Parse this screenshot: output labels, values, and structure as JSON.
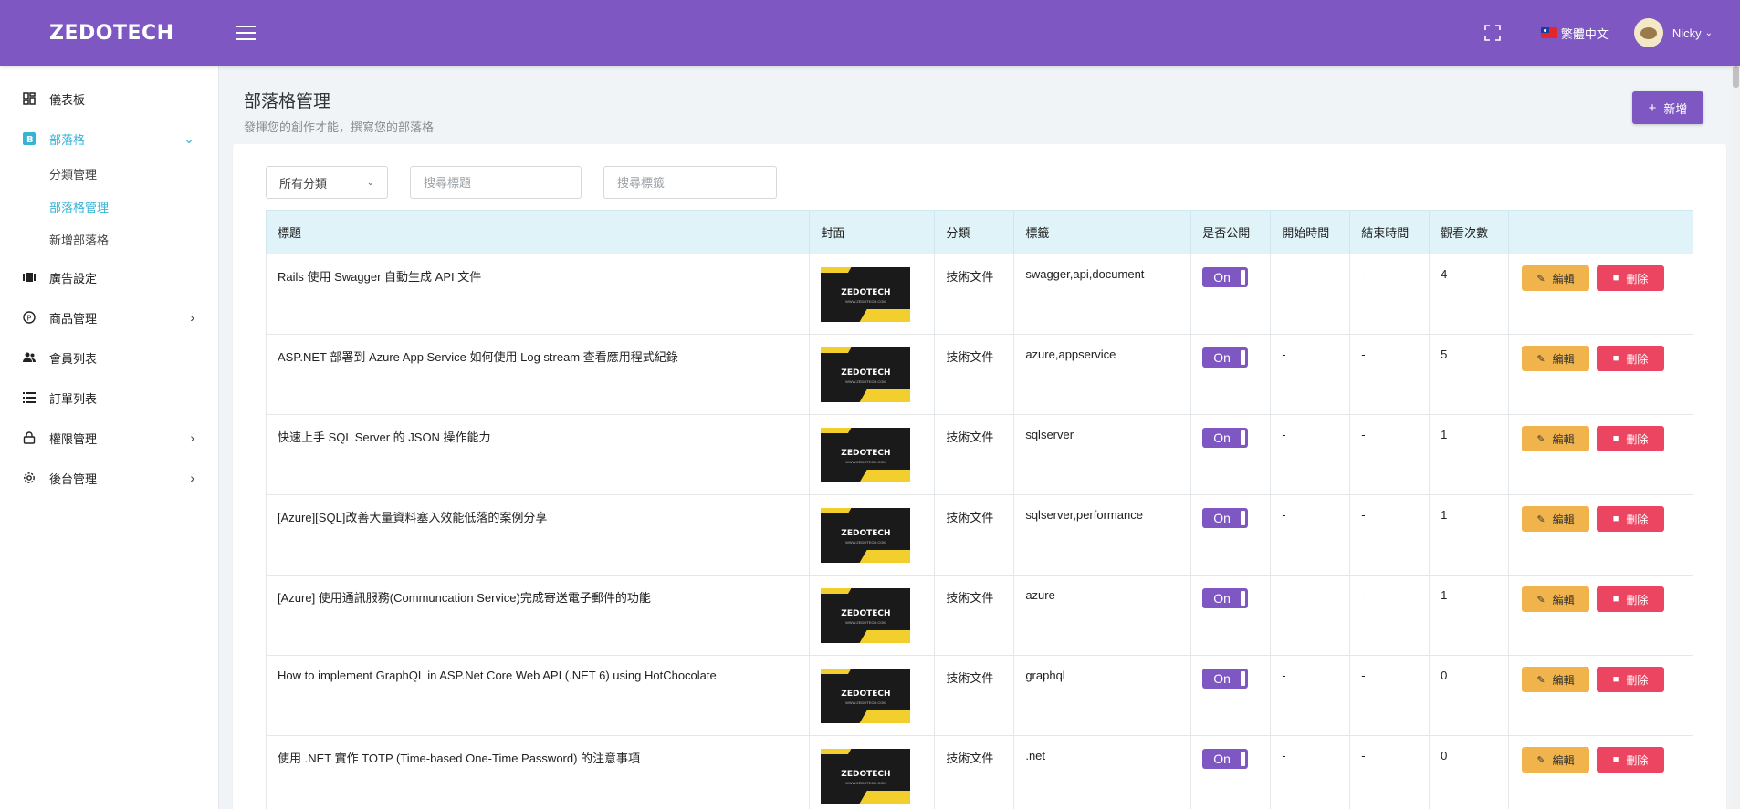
{
  "header": {
    "brand": "ZEDOTECH",
    "language": "繁體中文",
    "user_name": "Nicky"
  },
  "sidebar": {
    "items": [
      {
        "label": "儀表板"
      },
      {
        "label": "部落格"
      },
      {
        "label": "廣告設定"
      },
      {
        "label": "商品管理"
      },
      {
        "label": "會員列表"
      },
      {
        "label": "訂單列表"
      },
      {
        "label": "權限管理"
      },
      {
        "label": "後台管理"
      }
    ],
    "blog_sub": [
      {
        "label": "分類管理"
      },
      {
        "label": "部落格管理"
      },
      {
        "label": "新增部落格"
      }
    ]
  },
  "page": {
    "title": "部落格管理",
    "subtitle": "發揮您的創作才能，撰寫您的部落格",
    "add_label": "新增"
  },
  "filters": {
    "category_selected": "所有分類",
    "title_placeholder": "搜尋標題",
    "tag_placeholder": "搜尋標籤"
  },
  "table": {
    "columns": [
      "標題",
      "封面",
      "分類",
      "標籤",
      "是否公開",
      "開始時間",
      "結束時間",
      "觀看次數",
      ""
    ],
    "cover_logo": "ZEDOTECH",
    "cover_logo_sub": "WWW.ZEDOTECH.COM",
    "edit_label": "編輯",
    "delete_label": "刪除",
    "rows": [
      {
        "title": "Rails 使用 Swagger 自動生成 API 文件",
        "category": "技術文件",
        "tags": "swagger,api,document",
        "public": "On",
        "start": "-",
        "end": "-",
        "views": "4"
      },
      {
        "title": "ASP.NET 部署到 Azure App Service 如何使用 Log stream 查看應用程式紀錄",
        "category": "技術文件",
        "tags": "azure,appservice",
        "public": "On",
        "start": "-",
        "end": "-",
        "views": "5"
      },
      {
        "title": "快速上手 SQL Server 的 JSON 操作能力",
        "category": "技術文件",
        "tags": "sqlserver",
        "public": "On",
        "start": "-",
        "end": "-",
        "views": "1"
      },
      {
        "title": "[Azure][SQL]改善大量資料塞入效能低落的案例分享",
        "category": "技術文件",
        "tags": "sqlserver,performance",
        "public": "On",
        "start": "-",
        "end": "-",
        "views": "1"
      },
      {
        "title": "[Azure] 使用通訊服務(Communcation Service)完成寄送電子郵件的功能",
        "category": "技術文件",
        "tags": "azure",
        "public": "On",
        "start": "-",
        "end": "-",
        "views": "1"
      },
      {
        "title": "How to implement GraphQL in ASP.Net Core Web API (.NET 6) using HotChocolate",
        "category": "技術文件",
        "tags": "graphql",
        "public": "On",
        "start": "-",
        "end": "-",
        "views": "0"
      },
      {
        "title": "使用 .NET 實作 TOTP (Time-based One-Time Password) 的注意事項",
        "category": "技術文件",
        "tags": ".net",
        "public": "On",
        "start": "-",
        "end": "-",
        "views": "0"
      }
    ]
  },
  "colors": {
    "primary": "#7e57c2",
    "accent": "#36b3d6",
    "edit": "#f1b44c",
    "delete": "#ec4561",
    "table_header": "#dff3f8"
  }
}
